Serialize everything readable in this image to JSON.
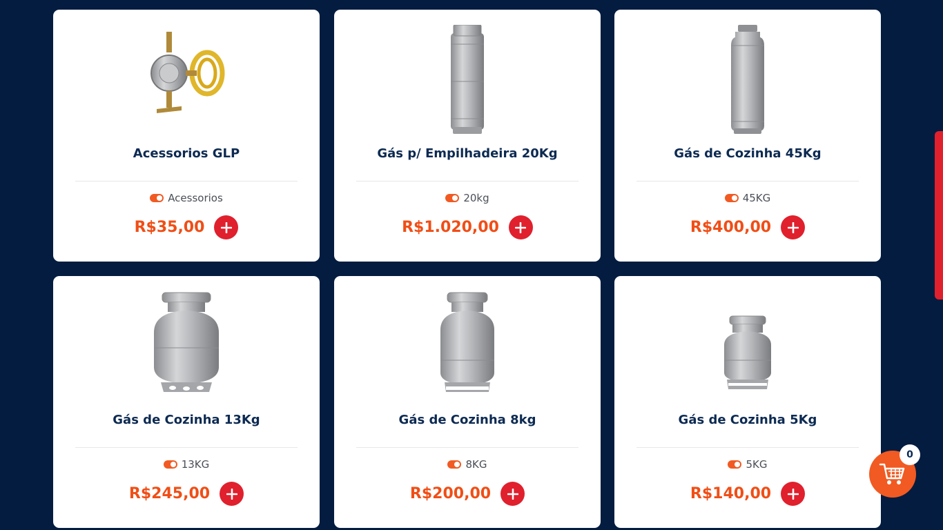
{
  "products": [
    {
      "title": "Acessorios GLP",
      "category": "Acessorios",
      "price": "R$35,00",
      "image": "gas-regulator-hose"
    },
    {
      "title": "Gás p/ Empilhadeira 20Kg",
      "category": "20kg",
      "price": "R$1.020,00",
      "image": "forklift-cylinder"
    },
    {
      "title": "Gás de Cozinha 45Kg",
      "category": "45KG",
      "price": "R$400,00",
      "image": "tall-cylinder"
    },
    {
      "title": "Gás de Cozinha 13Kg",
      "category": "13KG",
      "price": "R$245,00",
      "image": "cylinder-13kg"
    },
    {
      "title": "Gás de Cozinha 8kg",
      "category": "8KG",
      "price": "R$200,00",
      "image": "cylinder-8kg"
    },
    {
      "title": "Gás de Cozinha 5Kg",
      "category": "5KG",
      "price": "R$140,00",
      "image": "cylinder-5kg"
    }
  ],
  "cart": {
    "count": "0",
    "icon": "shopping-cart-icon"
  },
  "colors": {
    "background": "#031c40",
    "price": "#f04e16",
    "add_button": "#e0202d",
    "title": "#0c2a52"
  }
}
